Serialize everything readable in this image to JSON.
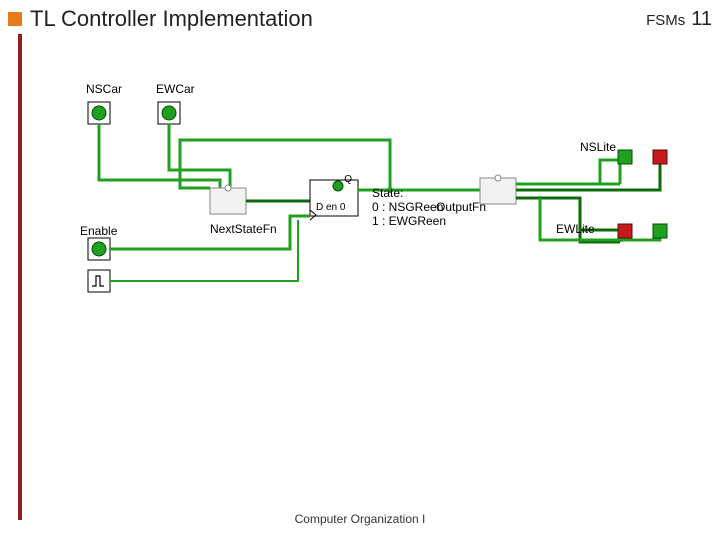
{
  "header": {
    "title": "TL Controller Implementation",
    "section": "FSMs",
    "page": "11"
  },
  "footer": {
    "credit": "Computer Organization I"
  },
  "circuit": {
    "inputs": {
      "nscar": "NSCar",
      "ewcar": "EWCar",
      "enable": "Enable"
    },
    "blocks": {
      "nextstate": "NextStateFn",
      "output": "OutputFn",
      "register": {
        "q": "Q",
        "d": "D en 0"
      }
    },
    "state_text": {
      "title": "State:",
      "line0": "0 : NSGReen",
      "line1": "1 : EWGReen"
    },
    "outputs": {
      "nslite": "NSLite",
      "ewlite": "EWLite"
    },
    "colors": {
      "wire_green": "#1fa01f",
      "wire_dark": "#0b6b0b",
      "led_green": "#1fa01f",
      "led_red": "#c61a1a"
    }
  }
}
